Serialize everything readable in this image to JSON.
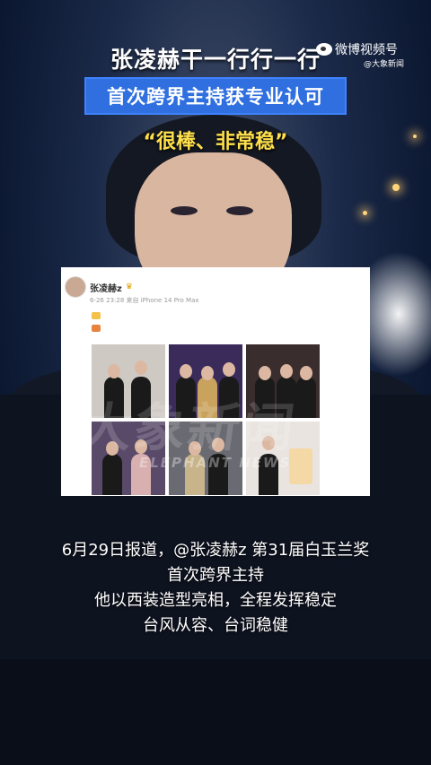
{
  "headline": "张凌赫干一行行一行",
  "banner": "首次跨界主持获专业认可",
  "quote": "“很棒、非常稳”",
  "watermark_top": {
    "brand": "微博视频号",
    "sub": "@大象新闻"
  },
  "post": {
    "username": "张凌赫z",
    "meta": "6-26 23:28 来自 iPhone 14 Pro Max",
    "images_count": 6
  },
  "overlay_watermark": {
    "big": "大象新闻",
    "small": "ELEPHANT NEWS"
  },
  "caption": [
    "6月29日报道，@张凌赫z 第31届白玉兰奖",
    "首次跨界主持",
    "他以西装造型亮相，全程发挥稳定",
    "台风从容、台词稳健"
  ],
  "colors": {
    "banner": "#2f6fe0",
    "quote": "#ffe04a",
    "background": "#0d1a33"
  }
}
